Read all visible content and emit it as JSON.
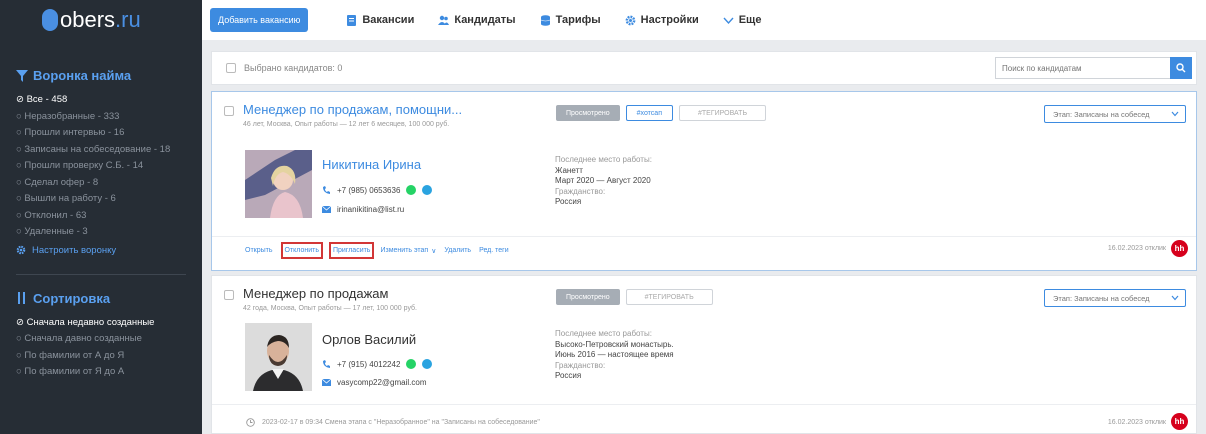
{
  "app": {
    "logo_main": "obers",
    "logo_tld": ".ru"
  },
  "sidebar": {
    "funnel_title": "Воронка найма",
    "funnel_items": [
      {
        "label": "⊘ Все - 458",
        "active": true
      },
      {
        "label": "○ Неразобранные - 333",
        "active": false
      },
      {
        "label": "○ Прошли интервью - 16",
        "active": false
      },
      {
        "label": "○ Записаны на собеседование - 18",
        "active": false
      },
      {
        "label": "○ Прошли проверку С.Б. - 14",
        "active": false
      },
      {
        "label": "○ Сделал офер - 8",
        "active": false
      },
      {
        "label": "○ Вышли на работу - 6",
        "active": false
      },
      {
        "label": "○ Отклонил - 63",
        "active": false
      },
      {
        "label": "○ Удаленные - 3",
        "active": false
      }
    ],
    "configure_funnel": "Настроить воронку",
    "sort_title": "Сортировка",
    "sort_items": [
      {
        "label": "⊘ Сначала недавно созданные",
        "active": true
      },
      {
        "label": "○ Сначала давно созданные",
        "active": false
      },
      {
        "label": "○ По фамилии от А до Я",
        "active": false
      },
      {
        "label": "○ По фамилии от Я до А",
        "active": false
      }
    ]
  },
  "topbar": {
    "add_vacancy": "Добавить вакансию",
    "nav": [
      "Вакансии",
      "Кандидаты",
      "Тарифы",
      "Настройки",
      "Еще"
    ]
  },
  "filter": {
    "selected_label": "Выбрано кандидатов: 0",
    "search_placeholder": "Поиск по кандидатам"
  },
  "cards": [
    {
      "job_title": "Менеджер по продажам, помощни...",
      "meta": "46 лет, Москва, Опыт работы — 12 лет 6 месяцев, 100 000 руб.",
      "tag_viewed": "Просмотрено",
      "tag_hashtag": "#хотсап",
      "tag_add": "#ТЕГИРОВАТЬ",
      "stage": "Этап: Записаны на собесед",
      "name": "Никитина Ирина",
      "phone": "+7 (985) 0653636",
      "email": "irinanikitina@list.ru",
      "work_label": "Последнее место работы:",
      "work_company": "Жанетт",
      "work_period": "Март 2020 — Август 2020",
      "citizenship_label": "Гражданство:",
      "citizenship": "Россия",
      "actions": {
        "open": "Открыть",
        "reject": "Отклонить",
        "invite": "Пригласить",
        "change_stage": "Изменить этап",
        "delete": "Удалить",
        "edit_tags": "Ред. теги"
      },
      "date": "16.02.2023 отклик",
      "hh": "hh"
    },
    {
      "job_title": "Менеджер по продажам",
      "meta": "42 года, Москва, Опыт работы — 17 лет, 100 000 руб.",
      "tag_viewed": "Просмотрено",
      "tag_add": "#ТЕГИРОВАТЬ",
      "stage": "Этап: Записаны на собесед",
      "name": "Орлов Василий",
      "phone": "+7 (915) 4012242",
      "email": "vasycomp22@gmail.com",
      "work_label": "Последнее место работы:",
      "work_company": "Высоко-Петровский монастырь.",
      "work_period": "Июнь 2016 — настоящее время",
      "citizenship_label": "Гражданство:",
      "citizenship": "Россия",
      "history": "2023-02-17 в 09:34 Смена этапа с \"Неразобранное\" на \"Записаны на собеседование\"",
      "date": "16.02.2023 отклик",
      "hh": "hh"
    }
  ],
  "colors": {
    "accent": "#3d8be0",
    "sidebar_bg": "#262d35",
    "highlight_border": "#d23636",
    "hh": "#d6001c"
  }
}
